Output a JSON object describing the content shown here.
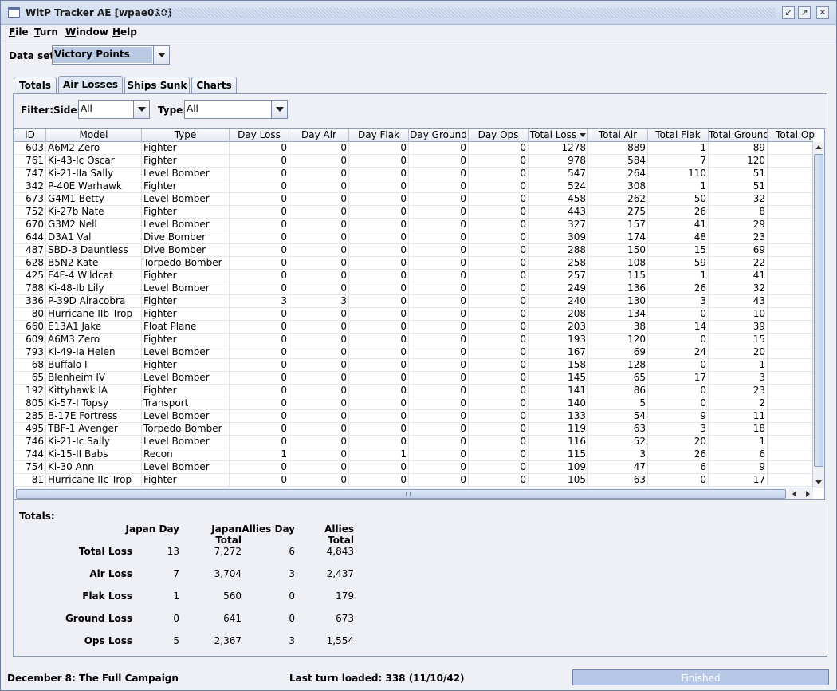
{
  "window": {
    "title": "WitP Tracker AE [wpae010]"
  },
  "menu": [
    "File",
    "Turn",
    "Window",
    "Help"
  ],
  "dataset": {
    "label": "Data set:",
    "value": "Victory Points"
  },
  "tabs": [
    {
      "label": "Totals",
      "active": false
    },
    {
      "label": "Air Losses",
      "active": true
    },
    {
      "label": "Ships Sunk",
      "active": false
    },
    {
      "label": "Charts",
      "active": false
    }
  ],
  "filter": {
    "label": "Filter:",
    "side_label": "Side:",
    "side_value": "All",
    "type_label": "Type:",
    "type_value": "All"
  },
  "table": {
    "columns": [
      "ID",
      "Model",
      "Type",
      "Day Loss",
      "Day Air",
      "Day Flak",
      "Day Ground",
      "Day Ops",
      "Total Loss",
      "Total Air",
      "Total Flak",
      "Total Ground",
      "Total Op"
    ],
    "sorted_column": "Total Loss",
    "rows": [
      [
        "603",
        "A6M2 Zero",
        "Fighter",
        "0",
        "0",
        "0",
        "0",
        "0",
        "1278",
        "889",
        "1",
        "89",
        "2"
      ],
      [
        "761",
        "Ki-43-Ic Oscar",
        "Fighter",
        "0",
        "0",
        "0",
        "0",
        "0",
        "978",
        "584",
        "7",
        "120",
        "2"
      ],
      [
        "747",
        "Ki-21-IIa Sally",
        "Level Bomber",
        "0",
        "0",
        "0",
        "0",
        "0",
        "547",
        "264",
        "110",
        "51",
        "1"
      ],
      [
        "342",
        "P-40E Warhawk",
        "Fighter",
        "0",
        "0",
        "0",
        "0",
        "0",
        "524",
        "308",
        "1",
        "51",
        "1"
      ],
      [
        "673",
        "G4M1 Betty",
        "Level Bomber",
        "0",
        "0",
        "0",
        "0",
        "0",
        "458",
        "262",
        "50",
        "32",
        "1"
      ],
      [
        "752",
        "Ki-27b Nate",
        "Fighter",
        "0",
        "0",
        "0",
        "0",
        "0",
        "443",
        "275",
        "26",
        "8",
        "1"
      ],
      [
        "670",
        "G3M2 Nell",
        "Level Bomber",
        "0",
        "0",
        "0",
        "0",
        "0",
        "327",
        "157",
        "41",
        "29",
        "1"
      ],
      [
        "644",
        "D3A1 Val",
        "Dive Bomber",
        "0",
        "0",
        "0",
        "0",
        "0",
        "309",
        "174",
        "48",
        "23",
        ""
      ],
      [
        "487",
        "SBD-3 Dauntless",
        "Dive Bomber",
        "0",
        "0",
        "0",
        "0",
        "0",
        "288",
        "150",
        "15",
        "69",
        ""
      ],
      [
        "628",
        "B5N2 Kate",
        "Torpedo Bomber",
        "0",
        "0",
        "0",
        "0",
        "0",
        "258",
        "108",
        "59",
        "22",
        ""
      ],
      [
        "425",
        "F4F-4 Wildcat",
        "Fighter",
        "0",
        "0",
        "0",
        "0",
        "0",
        "257",
        "115",
        "1",
        "41",
        "1"
      ],
      [
        "788",
        "Ki-48-Ib Lily",
        "Level Bomber",
        "0",
        "0",
        "0",
        "0",
        "0",
        "249",
        "136",
        "26",
        "32",
        ""
      ],
      [
        "336",
        "P-39D Airacobra",
        "Fighter",
        "3",
        "3",
        "0",
        "0",
        "0",
        "240",
        "130",
        "3",
        "43",
        ""
      ],
      [
        "80",
        "Hurricane IIb Trop",
        "Fighter",
        "0",
        "0",
        "0",
        "0",
        "0",
        "208",
        "134",
        "0",
        "10",
        ""
      ],
      [
        "660",
        "E13A1 Jake",
        "Float Plane",
        "0",
        "0",
        "0",
        "0",
        "0",
        "203",
        "38",
        "14",
        "39",
        "1"
      ],
      [
        "609",
        "A6M3 Zero",
        "Fighter",
        "0",
        "0",
        "0",
        "0",
        "0",
        "193",
        "120",
        "0",
        "15",
        ""
      ],
      [
        "793",
        "Ki-49-Ia Helen",
        "Level Bomber",
        "0",
        "0",
        "0",
        "0",
        "0",
        "167",
        "69",
        "24",
        "20",
        ""
      ],
      [
        "68",
        "Buffalo I",
        "Fighter",
        "0",
        "0",
        "0",
        "0",
        "0",
        "158",
        "128",
        "0",
        "1",
        ""
      ],
      [
        "65",
        "Blenheim IV",
        "Level Bomber",
        "0",
        "0",
        "0",
        "0",
        "0",
        "145",
        "65",
        "17",
        "3",
        ""
      ],
      [
        "192",
        "Kittyhawk IA",
        "Fighter",
        "0",
        "0",
        "0",
        "0",
        "0",
        "141",
        "86",
        "0",
        "23",
        ""
      ],
      [
        "805",
        "Ki-57-I Topsy",
        "Transport",
        "0",
        "0",
        "0",
        "0",
        "0",
        "140",
        "5",
        "0",
        "2",
        "1"
      ],
      [
        "285",
        "B-17E Fortress",
        "Level Bomber",
        "0",
        "0",
        "0",
        "0",
        "0",
        "133",
        "54",
        "9",
        "11",
        ""
      ],
      [
        "495",
        "TBF-1 Avenger",
        "Torpedo Bomber",
        "0",
        "0",
        "0",
        "0",
        "0",
        "119",
        "63",
        "3",
        "18",
        ""
      ],
      [
        "746",
        "Ki-21-Ic Sally",
        "Level Bomber",
        "0",
        "0",
        "0",
        "0",
        "0",
        "116",
        "52",
        "20",
        "1",
        ""
      ],
      [
        "744",
        "Ki-15-II Babs",
        "Recon",
        "1",
        "0",
        "1",
        "0",
        "0",
        "115",
        "3",
        "26",
        "6",
        ""
      ],
      [
        "754",
        "Ki-30 Ann",
        "Level Bomber",
        "0",
        "0",
        "0",
        "0",
        "0",
        "109",
        "47",
        "6",
        "9",
        ""
      ],
      [
        "81",
        "Hurricane IIc Trop",
        "Fighter",
        "0",
        "0",
        "0",
        "0",
        "0",
        "105",
        "63",
        "0",
        "17",
        ""
      ]
    ]
  },
  "totals": {
    "label": "Totals:",
    "headers": [
      "Japan Day",
      "Japan Total",
      "Allies Day",
      "Allies Total"
    ],
    "rows": [
      {
        "label": "Total Loss",
        "values": [
          "13",
          "7,272",
          "6",
          "4,843"
        ]
      },
      {
        "label": "Air Loss",
        "values": [
          "7",
          "3,704",
          "3",
          "2,437"
        ]
      },
      {
        "label": "Flak Loss",
        "values": [
          "1",
          "560",
          "0",
          "179"
        ]
      },
      {
        "label": "Ground Loss",
        "values": [
          "0",
          "641",
          "0",
          "673"
        ]
      },
      {
        "label": "Ops Loss",
        "values": [
          "5",
          "2,367",
          "3",
          "1,554"
        ]
      }
    ]
  },
  "status": {
    "scenario": "December 8: The Full Campaign",
    "last_turn": "Last turn loaded: 338 (11/10/42)",
    "progress_text": "Finished",
    "progress": 1.0
  },
  "colors": {
    "accent": "#b9c8e3",
    "border": "#8c9bb8",
    "background": "#eef0f6"
  }
}
